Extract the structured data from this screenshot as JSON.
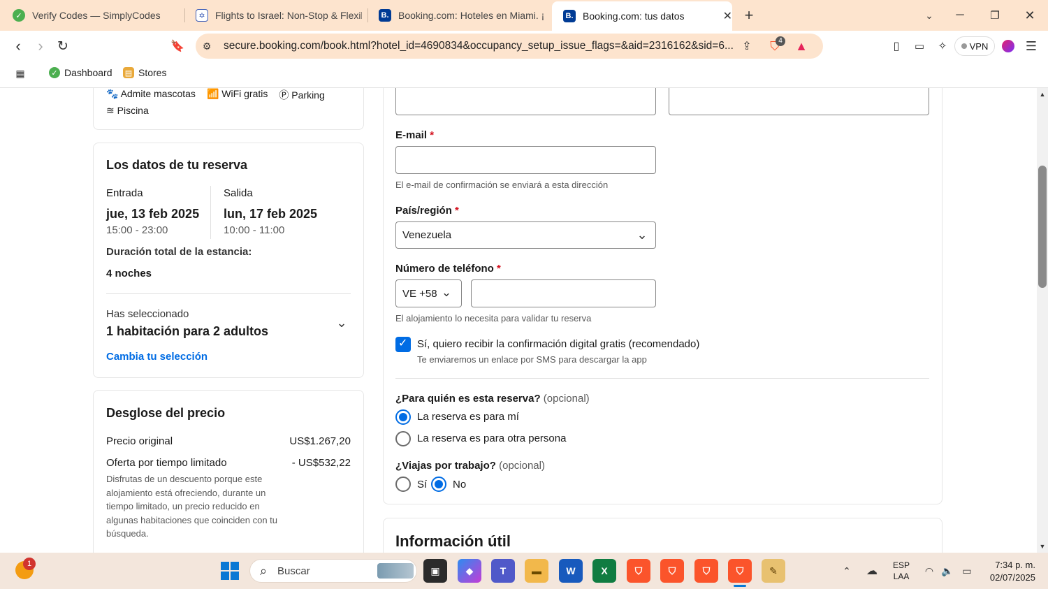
{
  "browser": {
    "tabs": [
      {
        "label": "Verify Codes — SimplyCodes",
        "icon": "simplycodes-icon"
      },
      {
        "label": "Flights to Israel: Non-Stop & Flexib",
        "icon": "israel-flag-icon"
      },
      {
        "label": "Booking.com: Hoteles en Miami. ¡Re",
        "icon": "booking-icon"
      },
      {
        "label": "Booking.com: tus datos",
        "icon": "booking-icon"
      }
    ],
    "url": "secure.booking.com/book.html?hotel_id=4690834&occupancy_setup_issue_flags=&aid=2316162&sid=6...",
    "brave_badge": "4",
    "vpn_label": "VPN",
    "bookmarks": [
      {
        "label": "Dashboard"
      },
      {
        "label": "Stores"
      }
    ]
  },
  "left": {
    "amenities": [
      "Admite mascotas",
      "WiFi gratis",
      "Parking",
      "Piscina"
    ],
    "reservation": {
      "title": "Los datos de tu reserva",
      "checkin_label": "Entrada",
      "checkin_date": "jue, 13 feb 2025",
      "checkin_time": "15:00 - 23:00",
      "checkout_label": "Salida",
      "checkout_date": "lun, 17 feb 2025",
      "checkout_time": "10:00 - 11:00",
      "duration_label": "Duración total de la estancia:",
      "duration_value": "4 noches",
      "selected_label": "Has seleccionado",
      "selected_value": "1 habitación para 2 adultos",
      "change_link": "Cambia tu selección"
    },
    "price": {
      "title": "Desglose del precio",
      "original_label": "Precio original",
      "original_value": "US$1.267,20",
      "offer_label": "Oferta por tiempo limitado",
      "offer_value": "- US$532,22",
      "offer_desc": "Disfrutas de un descuento porque este alojamiento está ofreciendo, durante un tiempo limitado, un precio reducido en algunas habitaciones que coinciden con tu búsqueda."
    }
  },
  "form": {
    "email_label": "E-mail",
    "required_mark": "*",
    "email_hint": "El e-mail de confirmación se enviará a esta dirección",
    "country_label": "País/región",
    "country_value": "Venezuela",
    "phone_label": "Número de teléfono",
    "phone_code": "VE +58",
    "phone_hint": "El alojamiento lo necesita para validar tu reserva",
    "digital_confirm": "Sí, quiero recibir la confirmación digital gratis (recomendado)",
    "digital_confirm_sub": "Te enviaremos un enlace por SMS para descargar la app",
    "for_whom_q": "¿Para quién es esta reserva?",
    "optional": "(opcional)",
    "for_me": "La reserva es para mí",
    "for_other": "La reserva es para otra persona",
    "work_q": "¿Viajas por trabajo?",
    "yes": "Sí",
    "no": "No",
    "useful_info_title": "Información útil"
  },
  "taskbar": {
    "search_placeholder": "Buscar",
    "notification_count": "1",
    "lang_1": "ESP",
    "lang_2": "LAA",
    "time": "7:34 p. m.",
    "date": "02/07/2025"
  }
}
